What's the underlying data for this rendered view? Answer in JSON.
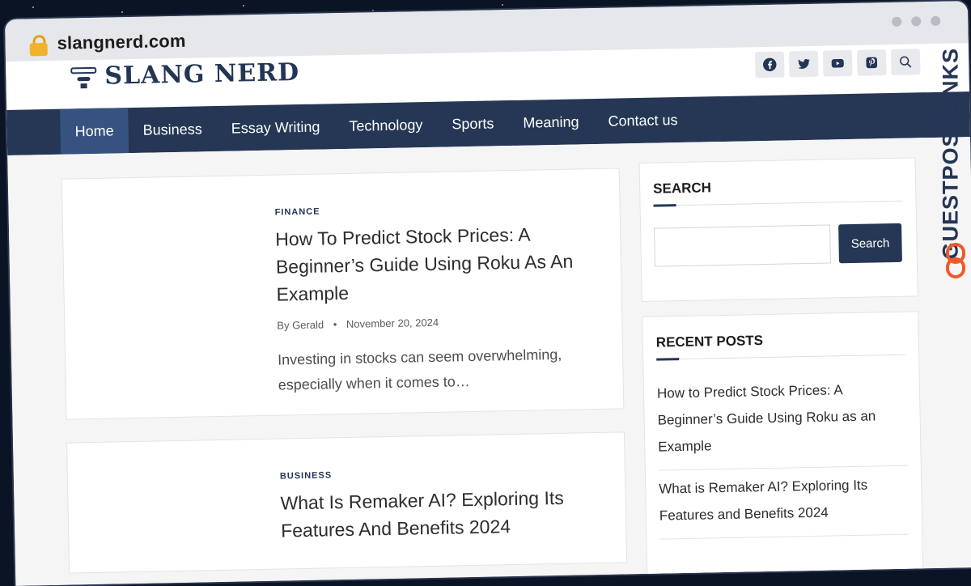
{
  "browser": {
    "url": "slangnerd.com"
  },
  "site": {
    "logo_text": "SLANG NERD"
  },
  "socials": [
    {
      "icon": "facebook-icon"
    },
    {
      "icon": "twitter-icon"
    },
    {
      "icon": "youtube-icon"
    },
    {
      "icon": "pinterest-icon"
    },
    {
      "icon": "search-icon"
    }
  ],
  "nav": {
    "items": [
      {
        "label": "Home"
      },
      {
        "label": "Business"
      },
      {
        "label": "Essay Writing"
      },
      {
        "label": "Technology"
      },
      {
        "label": "Sports"
      },
      {
        "label": "Meaning"
      },
      {
        "label": "Contact us"
      }
    ],
    "active": "Home"
  },
  "posts": [
    {
      "category": "FINANCE",
      "title": "How To Predict Stock Prices: A Beginner’s Guide Using Roku As An Example",
      "by": "By",
      "author": "Gerald",
      "date": "November 20, 2024",
      "excerpt": "Investing in stocks can seem overwhelming, especially when it comes to…"
    },
    {
      "category": "BUSINESS",
      "title": "What Is Remaker AI? Exploring Its Features And Benefits 2024"
    }
  ],
  "sidebar": {
    "search": {
      "title": "SEARCH",
      "button": "Search",
      "placeholder": ""
    },
    "recent": {
      "title": "RECENT POSTS",
      "items": [
        {
          "label": "How to Predict Stock Prices: A Beginner’s Guide Using Roku as an Example"
        },
        {
          "label": "What is Remaker AI? Exploring Its Features and Benefits 2024"
        }
      ]
    }
  },
  "watermark": {
    "text": "GUESTPOSTLINKS"
  },
  "colors": {
    "nav_bg": "#253755",
    "nav_active": "#35537e",
    "accent": "#243556",
    "watermark_orange": "#f0592a"
  }
}
